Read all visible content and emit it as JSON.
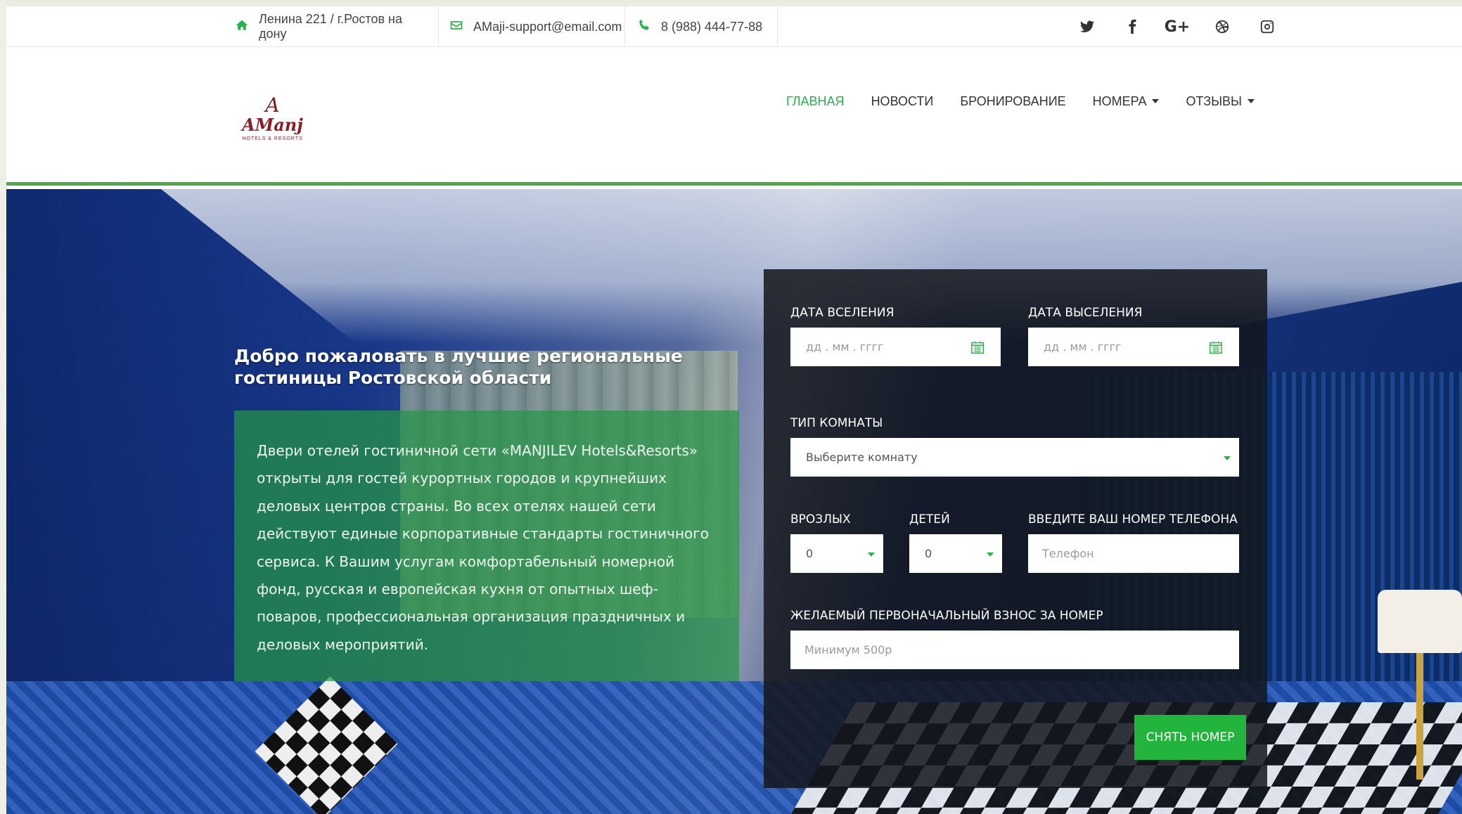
{
  "colors": {
    "accent": "#2bb24c",
    "brand": "#8b1d27"
  },
  "topbar": {
    "address": "Ленина 221 / г.Ростов на дону",
    "email": "AMaji-support@email.com",
    "phone": "8 (988) 444-77-88",
    "socials": [
      "twitter-icon",
      "facebook-icon",
      "google-plus-icon",
      "dribbble-icon",
      "instagram-icon"
    ]
  },
  "logo": {
    "monogram": "A",
    "wordmark": "AManj",
    "tagline": "HOTELS & RESORTS"
  },
  "nav": {
    "items": [
      {
        "label": "ГЛАВНАЯ",
        "active": true
      },
      {
        "label": "НОВОСТИ"
      },
      {
        "label": "БРОНИРОВАНИЕ"
      },
      {
        "label": "НОМЕРА",
        "dropdown": true
      },
      {
        "label": "ОТЗЫВЫ",
        "dropdown": true
      }
    ]
  },
  "hero": {
    "title": "Добро пожаловать в лучшие региональные гостиницы Ростовской области",
    "text": "Двери отелей гостиничной сети «MANJILEV Hotels&Resorts» открыты для гостей курортных городов и крупнейших деловых центров страны. Во всех отелях нашей сети действуют единые корпоративные стандарты гостиничного сервиса. К Вашим услугам комфортабельный номерной фонд, русская и европейская кухня от опытных шеф-поваров, профессиональная организация праздничных и деловых мероприятий."
  },
  "form": {
    "checkin_label": "ДАТА ВСЕЛЕНИЯ",
    "checkin_placeholder": "дд . мм . гггг",
    "checkout_label": "ДАТА ВЫСЕЛЕНИЯ",
    "checkout_placeholder": "дд . мм . гггг",
    "room_label": "ТИП КОМНАТЫ",
    "room_value": "Выберите комнату",
    "adults_label": "ВРОЗЛЫХ",
    "adults_value": "0",
    "children_label": "ДЕТЕЙ",
    "children_value": "0",
    "phone_label": "ВВЕДИТЕ ВАШ НОМЕР ТЕЛЕФОНА",
    "phone_placeholder": "Телефон",
    "deposit_label": "ЖЕЛАЕМЫЙ ПЕРВОНАЧАЛЬНЫЙ ВЗНОС ЗА НОМЕР",
    "deposit_placeholder": "Минимум 500р",
    "submit_label": "СНЯТЬ НОМЕР"
  }
}
